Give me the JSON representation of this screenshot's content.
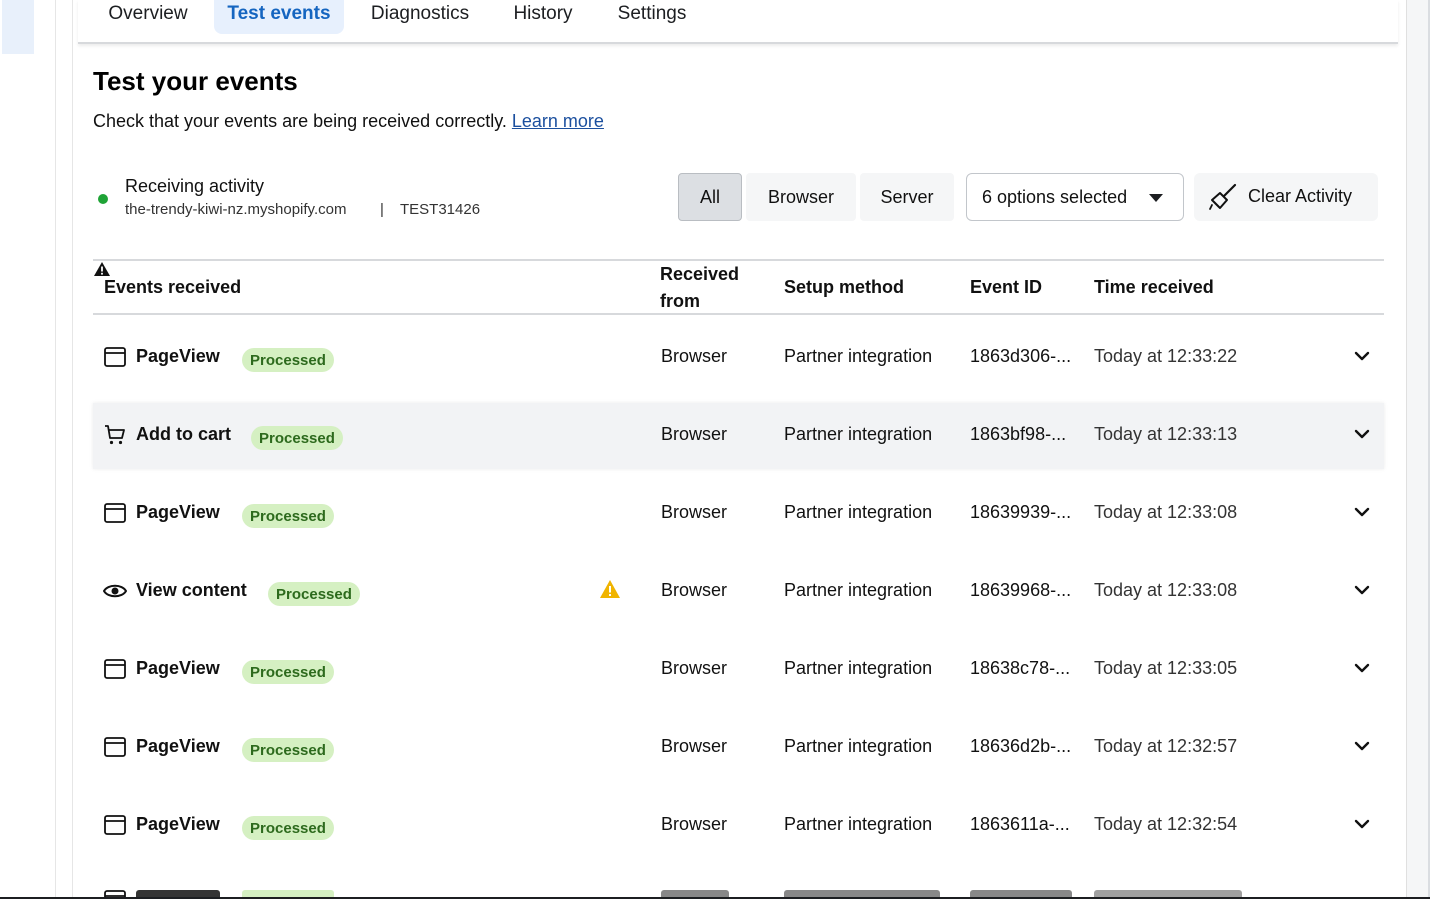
{
  "tabs": [
    {
      "label": "Overview"
    },
    {
      "label": "Test events",
      "active": true
    },
    {
      "label": "Diagnostics"
    },
    {
      "label": "History"
    },
    {
      "label": "Settings"
    }
  ],
  "page": {
    "title": "Test your events",
    "subtitle": "Check that your events are being received correctly.",
    "learn_more": "Learn more"
  },
  "receiving": {
    "title": "Receiving activity",
    "domain": "the-trendy-kiwi-nz.myshopify.com",
    "separator": "|",
    "test_code": "TEST31426",
    "status_color": "#1fa336"
  },
  "filters": {
    "all": "All",
    "browser": "Browser",
    "server": "Server",
    "selected": "All"
  },
  "dropdown": {
    "label": "6 options selected"
  },
  "clear_button": {
    "label": "Clear Activity"
  },
  "table": {
    "headers": {
      "events": "Events received",
      "received_from": "Received from",
      "setup_method": "Setup method",
      "event_id": "Event ID",
      "time_received": "Time received"
    },
    "rows": [
      {
        "icon": "browser-window-icon",
        "name": "PageView",
        "badge": "Processed",
        "warning": false,
        "from": "Browser",
        "setup": "Partner integration",
        "event_id": "1863d306-...",
        "time": "Today at 12:33:22"
      },
      {
        "icon": "cart-icon",
        "name": "Add to cart",
        "badge": "Processed",
        "warning": false,
        "from": "Browser",
        "setup": "Partner integration",
        "event_id": "1863bf98-...",
        "time": "Today at 12:33:13"
      },
      {
        "icon": "browser-window-icon",
        "name": "PageView",
        "badge": "Processed",
        "warning": false,
        "from": "Browser",
        "setup": "Partner integration",
        "event_id": "18639939-...",
        "time": "Today at 12:33:08"
      },
      {
        "icon": "eye-icon",
        "name": "View content",
        "badge": "Processed",
        "warning": true,
        "from": "Browser",
        "setup": "Partner integration",
        "event_id": "18639968-...",
        "time": "Today at 12:33:08"
      },
      {
        "icon": "browser-window-icon",
        "name": "PageView",
        "badge": "Processed",
        "warning": false,
        "from": "Browser",
        "setup": "Partner integration",
        "event_id": "18638c78-...",
        "time": "Today at 12:33:05"
      },
      {
        "icon": "browser-window-icon",
        "name": "PageView",
        "badge": "Processed",
        "warning": false,
        "from": "Browser",
        "setup": "Partner integration",
        "event_id": "18636d2b-...",
        "time": "Today at 12:32:57"
      },
      {
        "icon": "browser-window-icon",
        "name": "PageView",
        "badge": "Processed",
        "warning": false,
        "from": "Browser",
        "setup": "Partner integration",
        "event_id": "1863611a-...",
        "time": "Today at 12:32:54"
      }
    ]
  },
  "colors": {
    "accent": "#1565c0",
    "tab_active_bg": "#e7f0fd",
    "badge_bg": "#d5f0c2",
    "badge_text": "#2d6a1d",
    "warning": "#f0b400"
  }
}
